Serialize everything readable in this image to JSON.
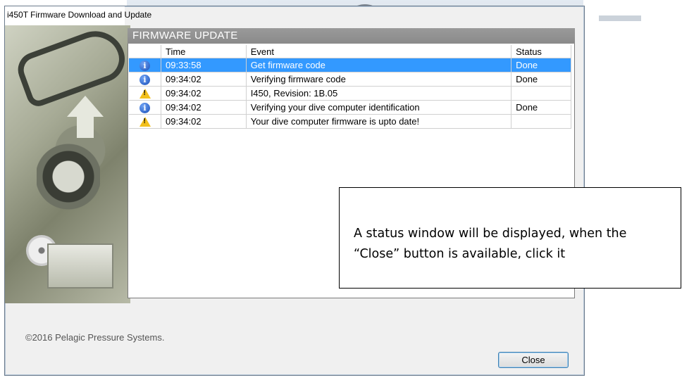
{
  "window": {
    "title": "i450T Firmware Download and Update"
  },
  "panel": {
    "header": "FIRMWARE UPDATE"
  },
  "table": {
    "columns": [
      "",
      "Time",
      "Event",
      "Status"
    ],
    "rows": [
      {
        "icon": "info-icon",
        "time": "09:33:58",
        "event": "Get firmware code",
        "status": "Done",
        "selected": true
      },
      {
        "icon": "info-icon",
        "time": "09:34:02",
        "event": "Verifying firmware code",
        "status": "Done",
        "selected": false
      },
      {
        "icon": "warning-icon",
        "time": "09:34:02",
        "event": "I450, Revision: 1B.05",
        "status": "",
        "selected": false
      },
      {
        "icon": "info-icon",
        "time": "09:34:02",
        "event": "Verifying your dive computer identification",
        "status": "Done",
        "selected": false
      },
      {
        "icon": "warning-icon",
        "time": "09:34:02",
        "event": "Your dive computer firmware is upto date!",
        "status": "",
        "selected": false
      }
    ]
  },
  "footer": {
    "copyright": "©2016 Pelagic Pressure Systems.",
    "close_label": "Close"
  },
  "callout": {
    "text": "A status window will be displayed, when the “Close” button is available, click it"
  },
  "colors": {
    "selection": "#3399ff",
    "header_bg": "#8f8f8f",
    "info_icon": "#1a4fb8",
    "warning_icon": "#f2c01d"
  }
}
